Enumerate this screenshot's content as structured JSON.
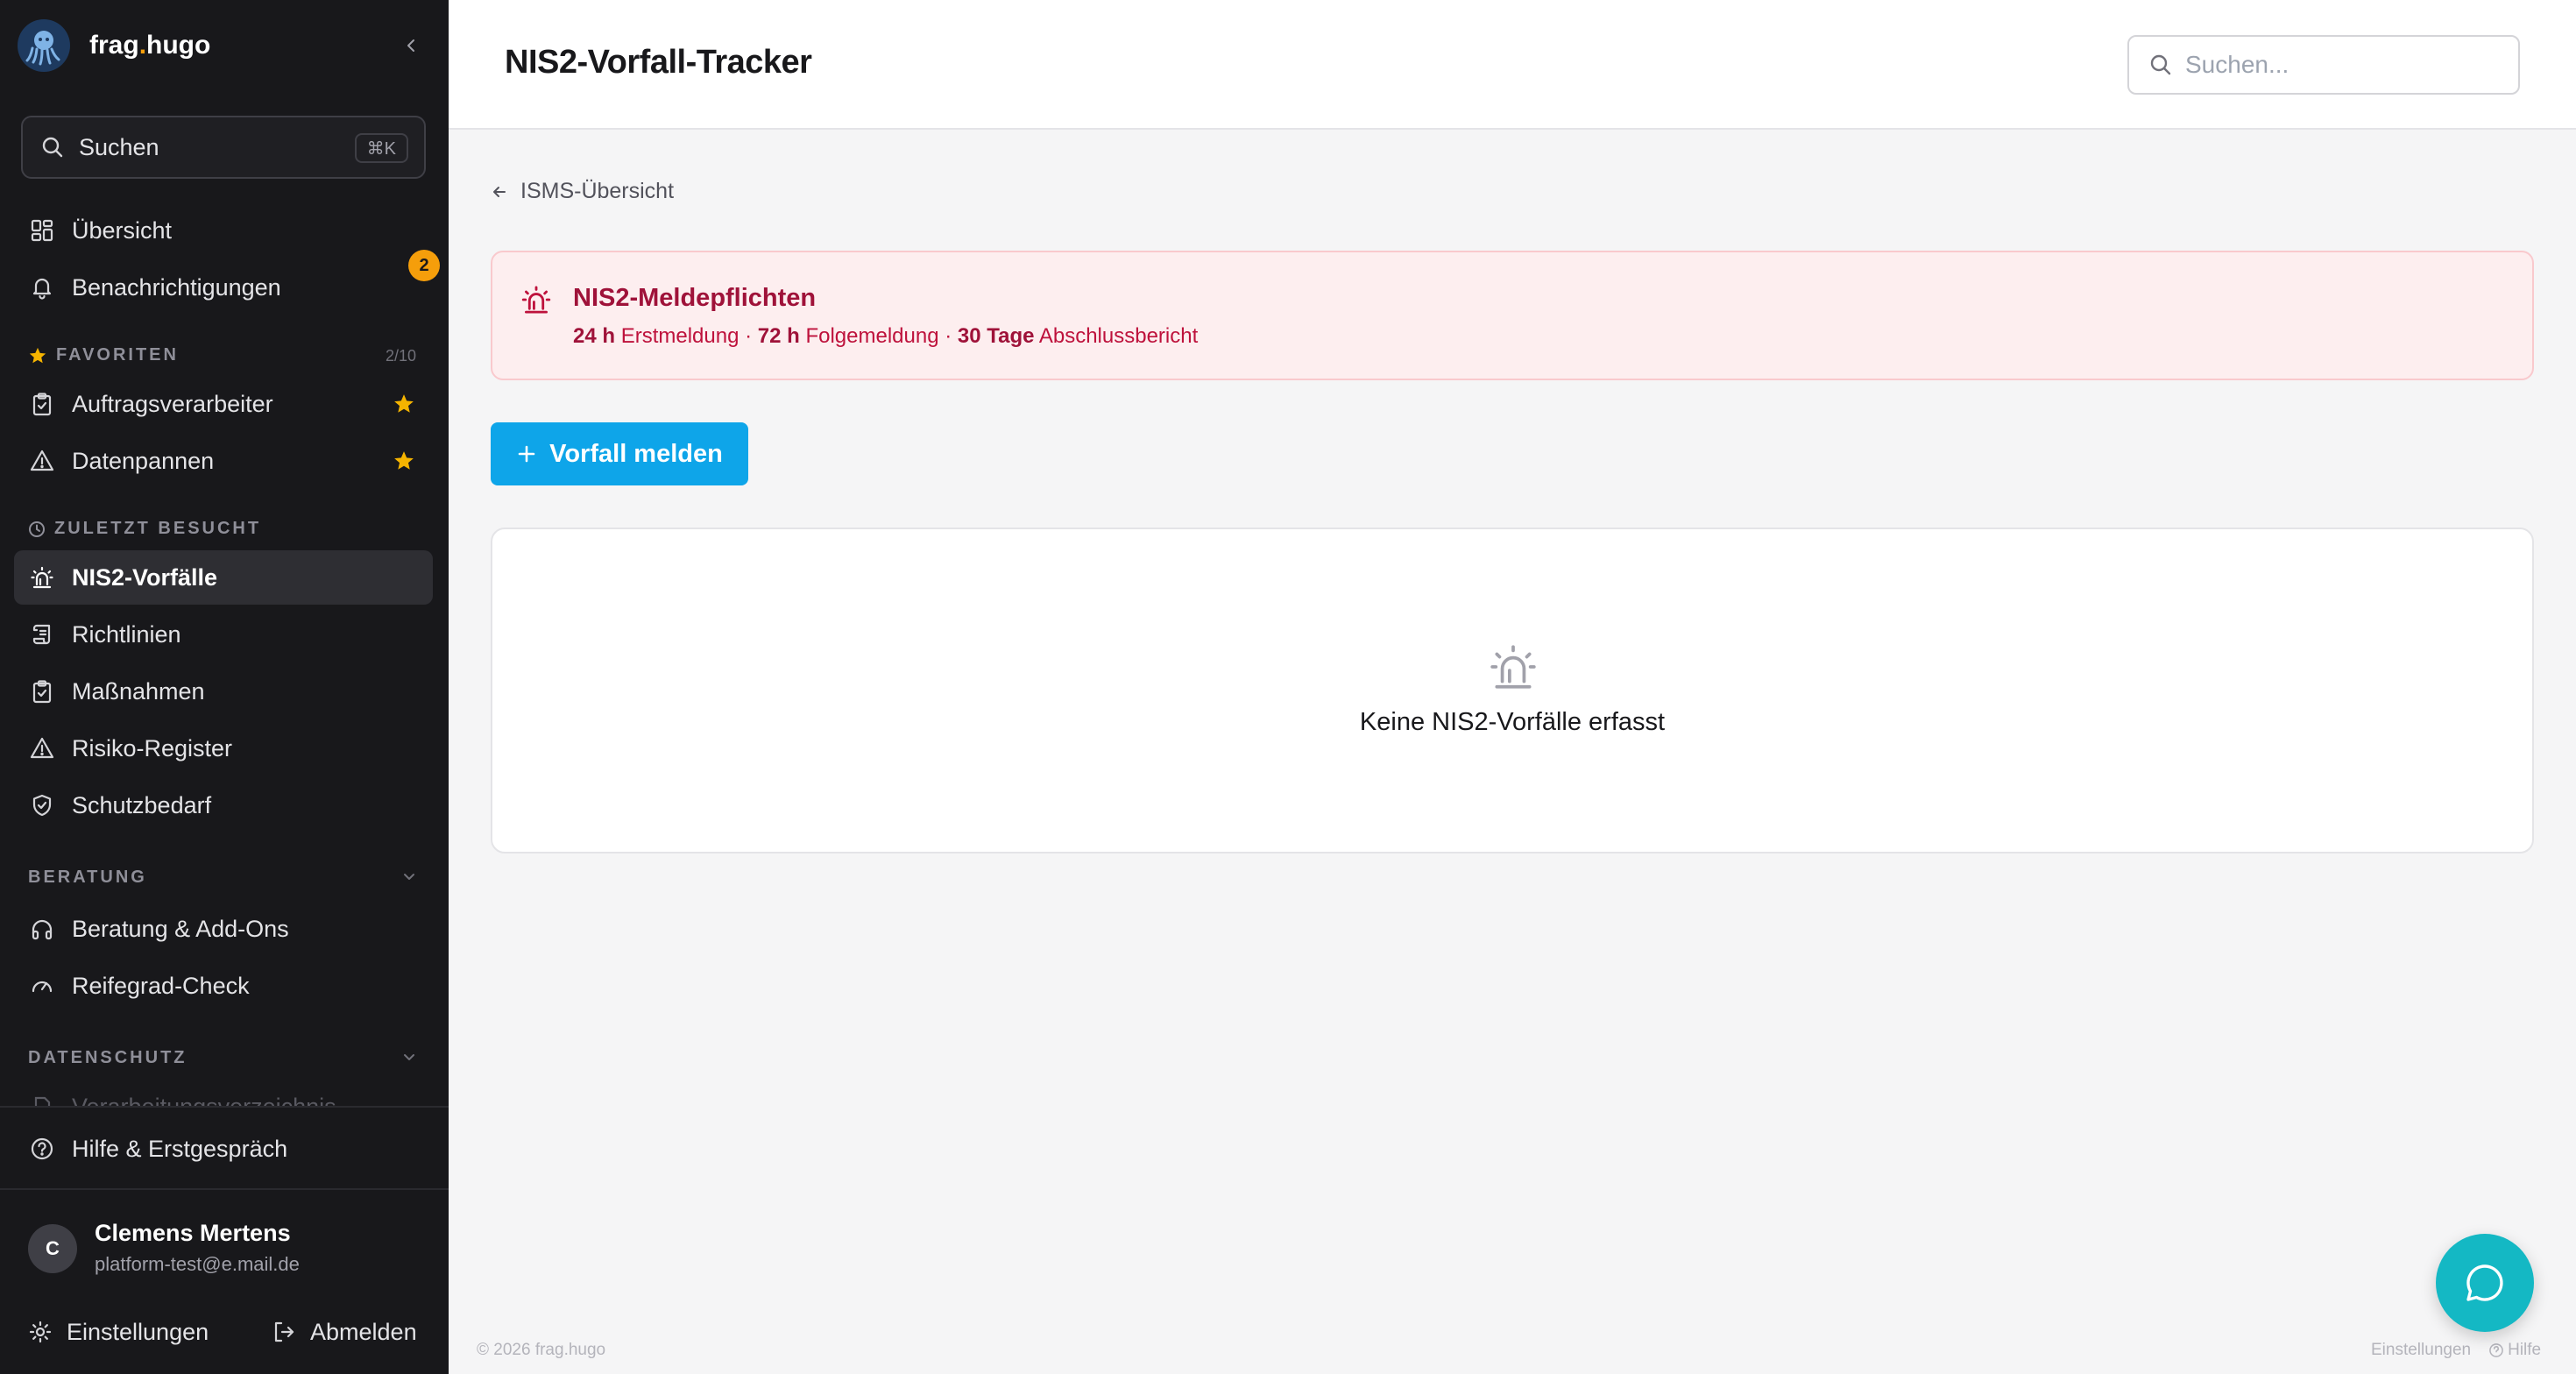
{
  "brand": {
    "name_part1": "frag",
    "name_dot": ".",
    "name_part2": "hugo"
  },
  "sidebar": {
    "search_label": "Suchen",
    "search_shortcut": "⌘K",
    "overview": "Übersicht",
    "notifications": "Benachrichtigungen",
    "notifications_count": "2",
    "favorites_label": "FAVORITEN",
    "favorites_count": "2/10",
    "favorites": [
      "Auftragsverarbeiter",
      "Datenpannen"
    ],
    "recent_label": "ZULETZT BESUCHT",
    "recent": [
      "NIS2-Vorfälle",
      "Richtlinien",
      "Maßnahmen",
      "Risiko-Register",
      "Schutzbedarf"
    ],
    "beratung_label": "BERATUNG",
    "beratung": [
      "Beratung & Add-Ons",
      "Reifegrad-Check"
    ],
    "datenschutz_label": "DATENSCHUTZ",
    "datenschutz_partial": "Verarbeitungsverzeichnis",
    "help": "Hilfe & Erstgespräch",
    "user": {
      "initial": "C",
      "name": "Clemens Mertens",
      "email": "platform-test@e.mail.de"
    },
    "settings": "Einstellungen",
    "logout": "Abmelden"
  },
  "header": {
    "title": "NIS2-Vorfall-Tracker",
    "search_placeholder": "Suchen..."
  },
  "main": {
    "breadcrumb": "ISMS-Übersicht",
    "alert": {
      "title": "NIS2-Meldepflichten",
      "t1": "24 h",
      "l1": " Erstmeldung · ",
      "t2": "72 h",
      "l2": " Folgemeldung · ",
      "t3": "30 Tage",
      "l3": " Abschlussbericht"
    },
    "report_button": "Vorfall melden",
    "empty_text": "Keine NIS2-Vorfälle erfasst"
  },
  "footer": {
    "copyright": "© 2026 frag.hugo",
    "settings": "Einstellungen",
    "help": "Hilfe"
  },
  "colors": {
    "sidebar_bg": "#18181b",
    "accent": "#0ea5e9",
    "badge": "#f59e0b",
    "alert_bg": "#fdeeef",
    "alert_text": "#9f1239",
    "chat_fab": "#14b8c4"
  }
}
